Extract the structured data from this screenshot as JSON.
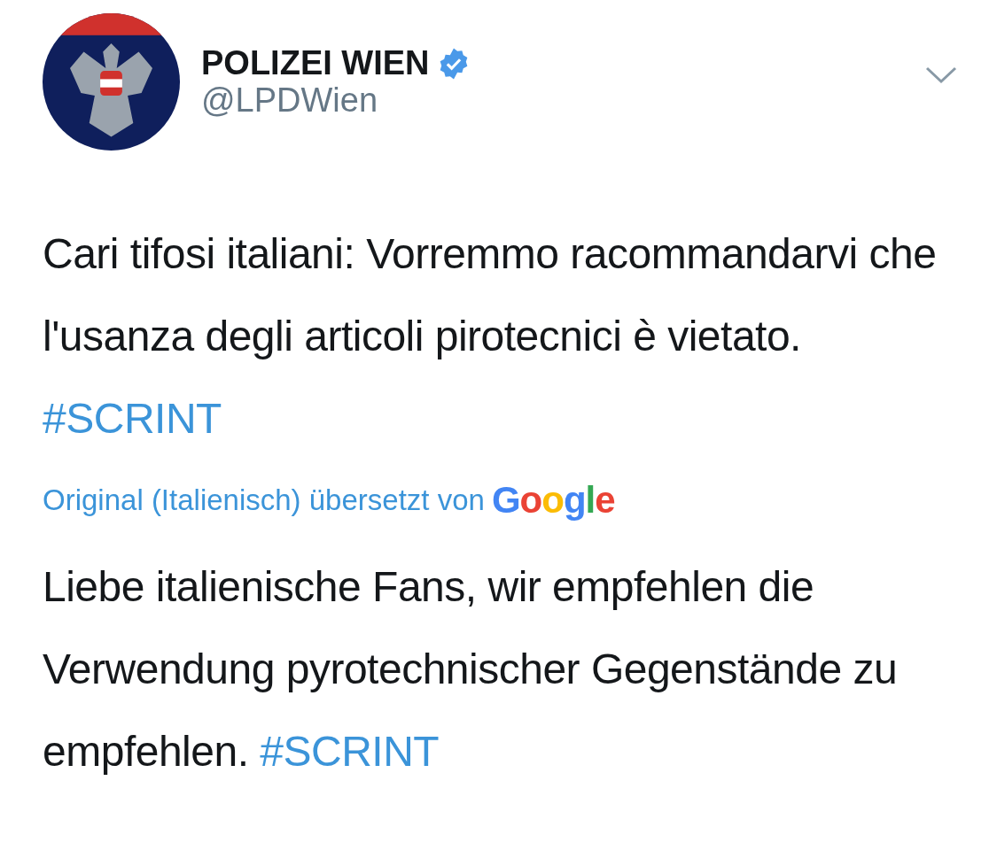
{
  "tweet": {
    "author": {
      "name": "POLIZEI WIEN",
      "verified": true,
      "handle": "@LPDWien"
    },
    "text": "Cari tifosi italiani: Vorremmo racommandarvi che l'usanza degli articoli pirotecnici è vietato.",
    "hashtag": "#SCRINT",
    "translation_note": "Original (Italienisch) übersetzt von",
    "translator": "Google",
    "translated_text": "Liebe italienische Fans, wir empfehlen die Verwendung pyrotechnischer Gegenstände zu empfehlen.",
    "translated_hashtag": "#SCRINT"
  }
}
